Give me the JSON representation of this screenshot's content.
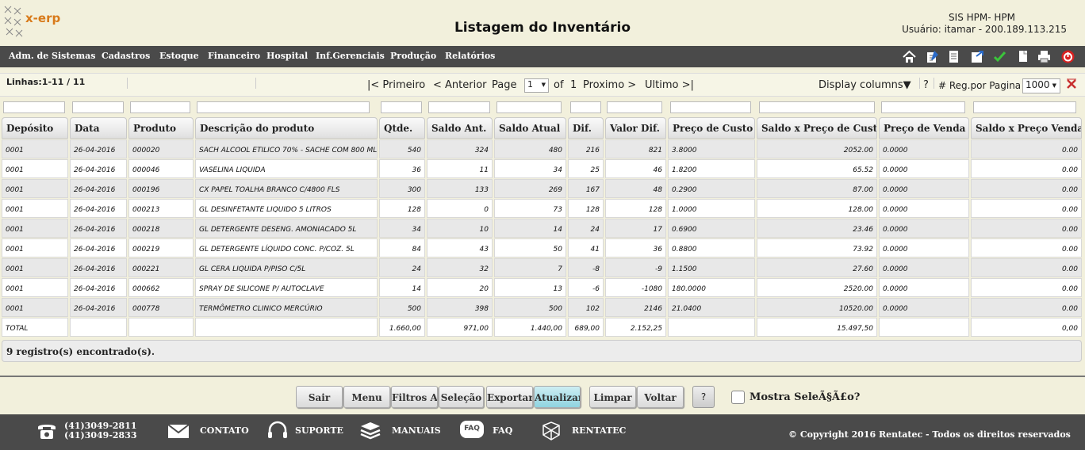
{
  "header": {
    "logo_text": "x-erp",
    "title": "Listagem do Inventário",
    "system": "SIS HPM- HPM",
    "user": "Usuário: itamar - 200.189.113.215"
  },
  "menu": [
    "Adm. de Sistemas",
    "Cadastros",
    "Estoque",
    "Financeiro",
    "Hospital",
    "Inf.Gerenciais",
    "Produção",
    "Relatórios"
  ],
  "toolbar_icons": [
    "home-icon",
    "edit-icon",
    "document-icon",
    "export-icon",
    "check-icon",
    "copy-icon",
    "print-icon",
    "power-icon"
  ],
  "nav": {
    "lines": "Linhas:1-11 / 11",
    "first": "|< Primeiro",
    "prev": "< Anterior",
    "page_label": "Page",
    "page_value": "1",
    "of": "of",
    "total_pages": "1",
    "next": "Proximo >",
    "last": "Ultimo >|",
    "display_columns": "Display columns▼",
    "help": "?",
    "reg_label": "# Reg.por Pagina",
    "reg_value": "1000"
  },
  "columns": [
    "Depósito",
    "Data",
    "Produto",
    "Descrição do produto",
    "Qtde.",
    "Saldo Ant.",
    "Saldo Atual",
    "Dif.",
    "Valor Dif.",
    "Preço de Custo",
    "Saldo x Preço de Custo",
    "Preço de Venda",
    "Saldo x Preço Venda"
  ],
  "rows": [
    [
      "0001",
      "26-04-2016",
      "000020",
      "SACH ALCOOL ETILICO 70% - SACHE COM 800 ML",
      "540",
      "324",
      "480",
      "216",
      "821",
      "3.8000",
      "2052.00",
      "0.0000",
      "0.00"
    ],
    [
      "0001",
      "26-04-2016",
      "000046",
      "VASELINA LIQUIDA",
      "36",
      "11",
      "34",
      "25",
      "46",
      "1.8200",
      "65.52",
      "0.0000",
      "0.00"
    ],
    [
      "0001",
      "26-04-2016",
      "000196",
      "CX PAPEL TOALHA BRANCO C/4800 FLS",
      "300",
      "133",
      "269",
      "167",
      "48",
      "0.2900",
      "87.00",
      "0.0000",
      "0.00"
    ],
    [
      "0001",
      "26-04-2016",
      "000213",
      "GL DESINFETANTE LIQUIDO 5 LITROS",
      "128",
      "0",
      "73",
      "128",
      "128",
      "1.0000",
      "128.00",
      "0.0000",
      "0.00"
    ],
    [
      "0001",
      "26-04-2016",
      "000218",
      "GL DETERGENTE DESENG. AMONIACADO 5L",
      "34",
      "10",
      "14",
      "24",
      "17",
      "0.6900",
      "23.46",
      "0.0000",
      "0.00"
    ],
    [
      "0001",
      "26-04-2016",
      "000219",
      "GL DETERGENTE LÍQUIDO CONC. P/COZ. 5L",
      "84",
      "43",
      "50",
      "41",
      "36",
      "0.8800",
      "73.92",
      "0.0000",
      "0.00"
    ],
    [
      "0001",
      "26-04-2016",
      "000221",
      "GL CERA LIQUIDA P/PISO C/5L",
      "24",
      "32",
      "7",
      "-8",
      "-9",
      "1.1500",
      "27.60",
      "0.0000",
      "0.00"
    ],
    [
      "0001",
      "26-04-2016",
      "000662",
      "SPRAY DE SILICONE P/ AUTOCLAVE",
      "14",
      "20",
      "13",
      "-6",
      "-1080",
      "180.0000",
      "2520.00",
      "0.0000",
      "0.00"
    ],
    [
      "0001",
      "26-04-2016",
      "000778",
      "TERMÔMETRO CLINICO MERCÚRIO",
      "500",
      "398",
      "500",
      "102",
      "2146",
      "21.0400",
      "10520.00",
      "0.0000",
      "0.00"
    ]
  ],
  "total_row": [
    "TOTAL",
    "",
    "",
    "",
    "1.660,00",
    "971,00",
    "1.440,00",
    "689,00",
    "2.152,25",
    "",
    "15.497,50",
    "",
    "0,00"
  ],
  "records_text": "9 registro(s) encontrado(s).",
  "buttons": [
    "Sair",
    "Menu",
    "Filtros Av",
    "Seleção",
    "Exportar",
    "Atualizar",
    "Limpar",
    "Voltar"
  ],
  "help_button": "?",
  "checkbox_label": "Mostra SeleÃ§Ã£o?",
  "footer": {
    "phone1": "(41)3049-2811",
    "phone2": "(41)3049-2833",
    "contato": "CONTATO",
    "suporte": "SUPORTE",
    "manuais": "MANUAIS",
    "faq": "FAQ",
    "faq_icon_text": "FAQ",
    "rentatec": "RENTATEC",
    "copyright": "© Copyright 2016 Rentatec - Todos os direitos reservados"
  }
}
